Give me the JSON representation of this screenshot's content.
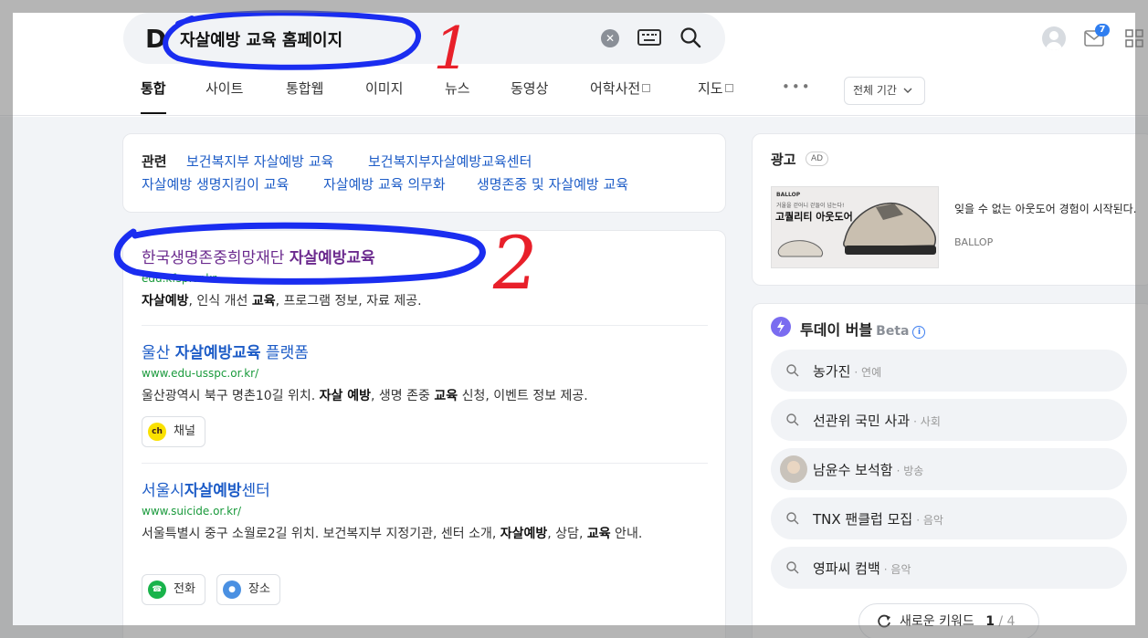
{
  "search": {
    "logo": "D",
    "query": "자살예방 교육 홈페이지"
  },
  "header": {
    "mail_count": "7"
  },
  "tabs": [
    {
      "label": "통합",
      "active": true
    },
    {
      "label": "사이트"
    },
    {
      "label": "통합웹"
    },
    {
      "label": "이미지"
    },
    {
      "label": "뉴스"
    },
    {
      "label": "동영상"
    },
    {
      "label": "어학사전"
    },
    {
      "label": "지도"
    }
  ],
  "more_label": "•••",
  "period_label": "전체 기간",
  "related": {
    "title": "관련",
    "links": [
      "보건복지부 자살예방 교육",
      "보건복지부자살예방교육센터",
      "자살예방 생명지킴이 교육",
      "자살예방 교육 의무화",
      "생명존중 및 자살예방 교육"
    ]
  },
  "results": [
    {
      "title_plain": "한국생명존중희망재단 ",
      "title_bold": "자살예방교육",
      "url": "edu.kfsp.or.kr",
      "desc": [
        {
          "t": "자살예방",
          "b": true
        },
        {
          "t": ", 인식 개선 "
        },
        {
          "t": "교육",
          "b": true
        },
        {
          "t": ", 프로그램 정보, 자료 제공."
        }
      ]
    },
    {
      "title_pre": "울산 ",
      "title_bold": "자살예방교육",
      "title_post": " 플랫폼",
      "url": "www.edu-usspc.or.kr/",
      "desc": [
        {
          "t": "울산광역시 북구 명촌10길 위치. "
        },
        {
          "t": "자살 예방",
          "b": true
        },
        {
          "t": ", 생명 존중 "
        },
        {
          "t": "교육",
          "b": true
        },
        {
          "t": " 신청, 이벤트 정보 제공."
        }
      ],
      "chips": [
        "채널"
      ]
    },
    {
      "title_pre": "서울시",
      "title_bold": "자살예방",
      "title_post": "센터",
      "url": "www.suicide.or.kr/",
      "desc": [
        {
          "t": "서울특별시 중구 소월로2길 위치. 보건복지부 지정기관, 센터 소개, "
        },
        {
          "t": "자살예방",
          "b": true
        },
        {
          "t": ", 상담, "
        },
        {
          "t": "교육",
          "b": true
        },
        {
          "t": " 안내."
        }
      ],
      "chips": [
        "전화",
        "장소"
      ]
    }
  ],
  "ad": {
    "title": "광고",
    "badge": "AD",
    "image_brand": "BALLOP",
    "image_small": "거울을 걷어니 걷들이 넘는다!",
    "image_headline": "고퀄리티 아웃도어",
    "text": "잊을 수 없는 아웃도어 경험이 시작된다.",
    "brand": "BALLOP"
  },
  "today_bubble": {
    "title": "투데이 버블",
    "beta": "Beta",
    "info": "i",
    "keywords": [
      {
        "label": "농가진",
        "category": "연예"
      },
      {
        "label": "선관위 국민 사과",
        "category": "사회"
      },
      {
        "label": "남윤수 보석함",
        "category": "방송",
        "face": true
      },
      {
        "label": "TNX 팬클럽 모집",
        "category": "음악"
      },
      {
        "label": "영파씨 컴백",
        "category": "음악"
      }
    ],
    "new_keyword_label": "새로운 키워드",
    "page_current": "1",
    "page_total": "/ 4"
  },
  "annotations": [
    "1",
    "2"
  ],
  "colors": {
    "link_blue": "#1d5cc7",
    "visited_purple": "#6b2a8e",
    "url_green": "#1a9a3c",
    "annotation_blue": "#1a2df0",
    "annotation_red": "#e8202a"
  }
}
